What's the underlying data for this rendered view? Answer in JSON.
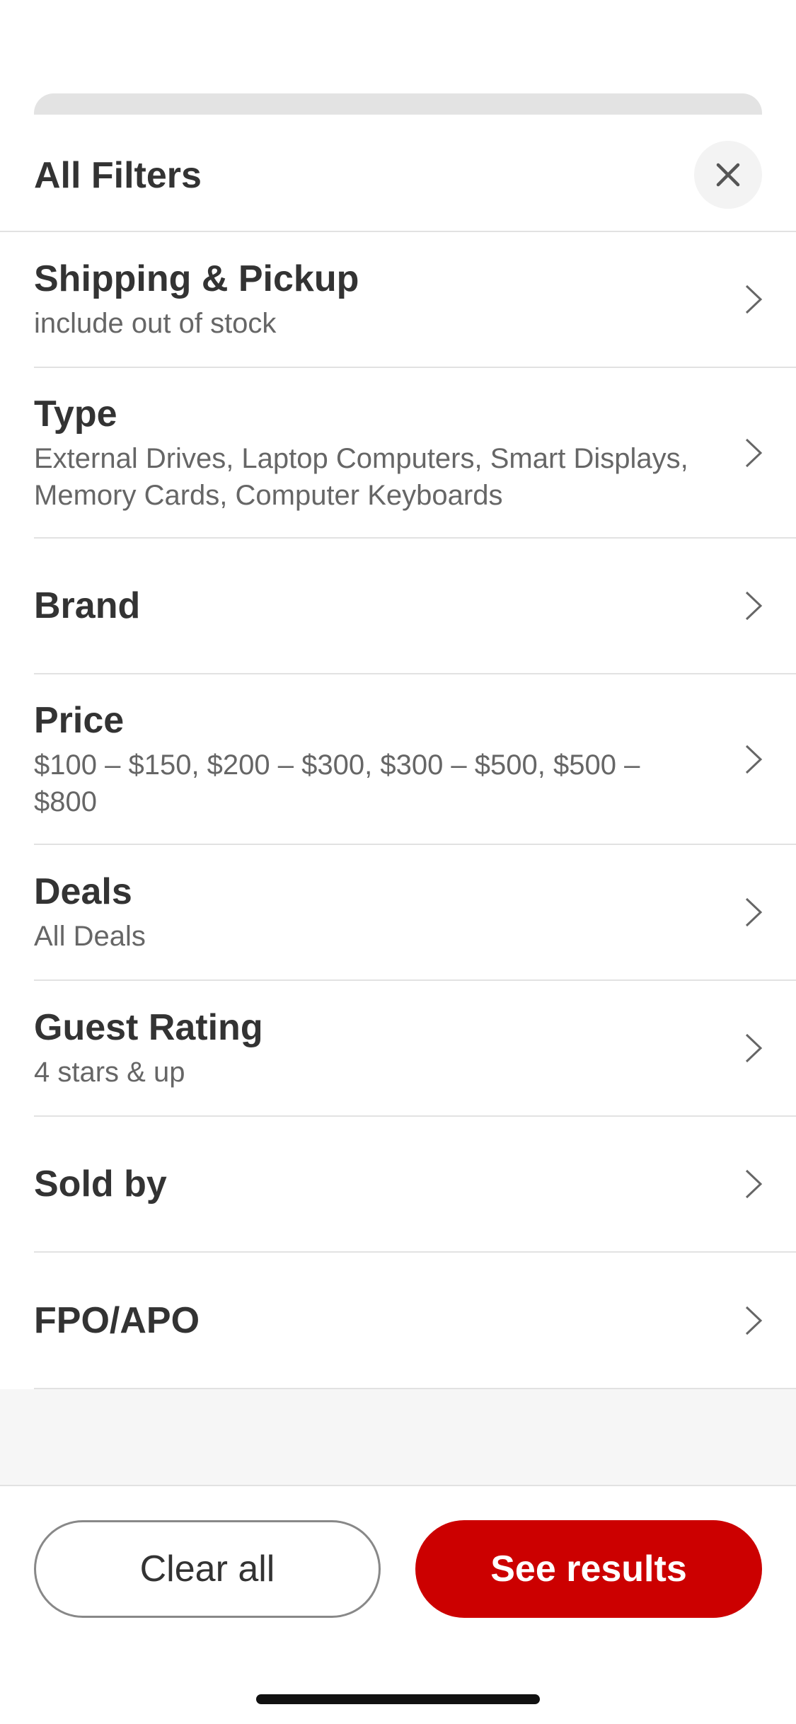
{
  "header": {
    "title": "All Filters",
    "close_icon": "close-icon"
  },
  "filters": [
    {
      "title": "Shipping & Pickup",
      "subtitle": "include out of stock"
    },
    {
      "title": "Type",
      "subtitle": "External Drives, Laptop Computers, Smart Displays, Memory Cards, Computer Keyboards"
    },
    {
      "title": "Brand",
      "subtitle": ""
    },
    {
      "title": "Price",
      "subtitle": "$100  –  $150, $200  –  $300, $300  –  $500, $500  –  $800"
    },
    {
      "title": "Deals",
      "subtitle": "All Deals"
    },
    {
      "title": "Guest Rating",
      "subtitle": "4 stars & up"
    },
    {
      "title": "Sold by",
      "subtitle": ""
    },
    {
      "title": "FPO/APO",
      "subtitle": ""
    }
  ],
  "footer": {
    "clear_label": "Clear all",
    "results_label": "See results"
  },
  "colors": {
    "accent": "#cc0000",
    "text_primary": "#333333",
    "text_secondary": "#666666",
    "divider": "#e2e2e2"
  },
  "icons": {
    "row_chevron": "chevron-right-icon"
  }
}
